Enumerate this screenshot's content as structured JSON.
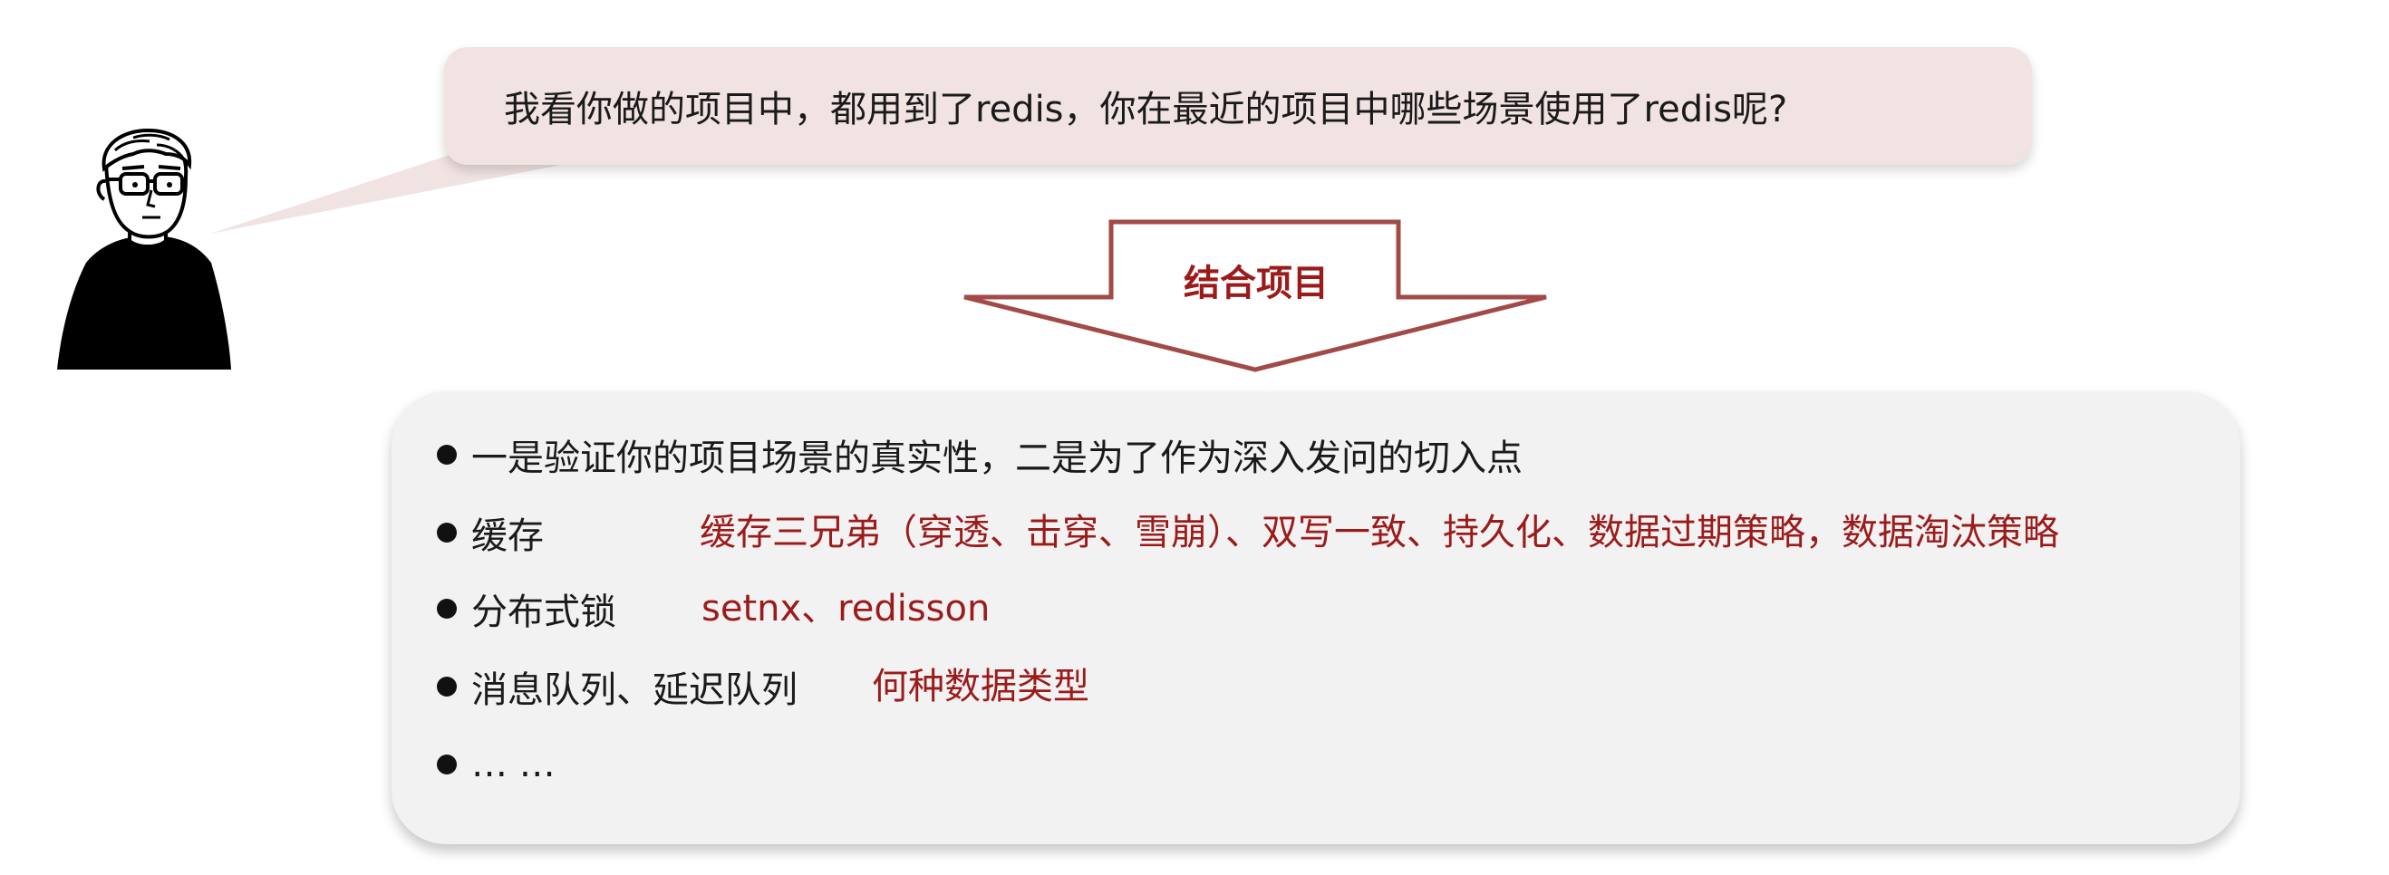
{
  "question": {
    "text": "我看你做的项目中，都用到了redis，你在最近的项目中哪些场景使用了redis呢?"
  },
  "arrow": {
    "label": "结合项目"
  },
  "points": [
    {
      "label": "一是验证你的项目场景的真实性，二是为了作为深入发问的切入点",
      "detail": ""
    },
    {
      "label": "缓存",
      "detail": "缓存三兄弟（穿透、击穿、雪崩）、双写一致、持久化、数据过期策略，数据淘汰策略"
    },
    {
      "label": "分布式锁",
      "detail": "setnx、redisson"
    },
    {
      "label": "消息队列、延迟队列",
      "detail": "何种数据类型"
    },
    {
      "label": "… …",
      "detail": ""
    }
  ],
  "colors": {
    "bubble_fill": "#f1e3e2",
    "accent_red": "#9b1b1b",
    "arrow_stroke": "#a24a48",
    "box_fill": "#f2f2f2"
  }
}
